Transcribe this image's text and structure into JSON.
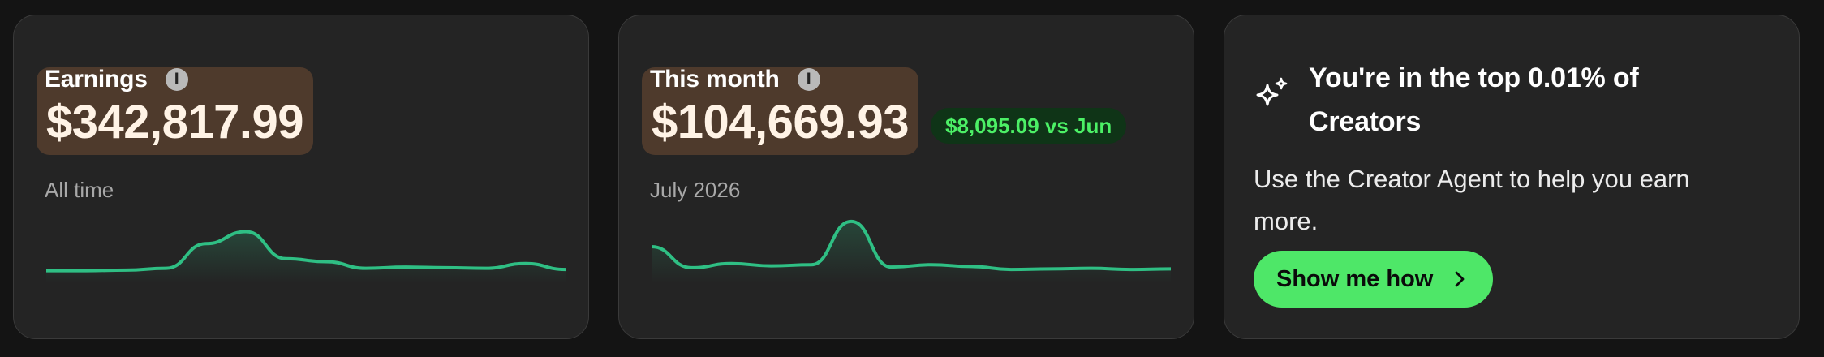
{
  "earnings": {
    "label": "Earnings",
    "amount": "$342,817.99",
    "sublabel": "All time",
    "info_icon": "info-icon",
    "sparkline": [
      0.1,
      0.1,
      0.11,
      0.14,
      0.55,
      0.75,
      0.3,
      0.25,
      0.14,
      0.16,
      0.15,
      0.14,
      0.22,
      0.12
    ]
  },
  "month": {
    "label": "This month",
    "amount": "$104,669.93",
    "delta": "$8,095.09 vs Jun",
    "sublabel": "July 2026",
    "info_icon": "info-icon",
    "sparkline": [
      0.5,
      0.15,
      0.22,
      0.18,
      0.2,
      0.92,
      0.16,
      0.2,
      0.17,
      0.12,
      0.13,
      0.14,
      0.12,
      0.13
    ]
  },
  "promo": {
    "title": "You're in the top 0.01% of Creators",
    "body": "Use the Creator Agent to help you earn more.",
    "cta_label": "Show me how",
    "icon": "sparkle-icon",
    "cta_icon": "chevron-right-icon"
  },
  "colors": {
    "accent_green": "#4ee768",
    "line_green": "#2fbf84",
    "amount_highlight": "#4e3a2c",
    "card_bg": "#242424"
  }
}
